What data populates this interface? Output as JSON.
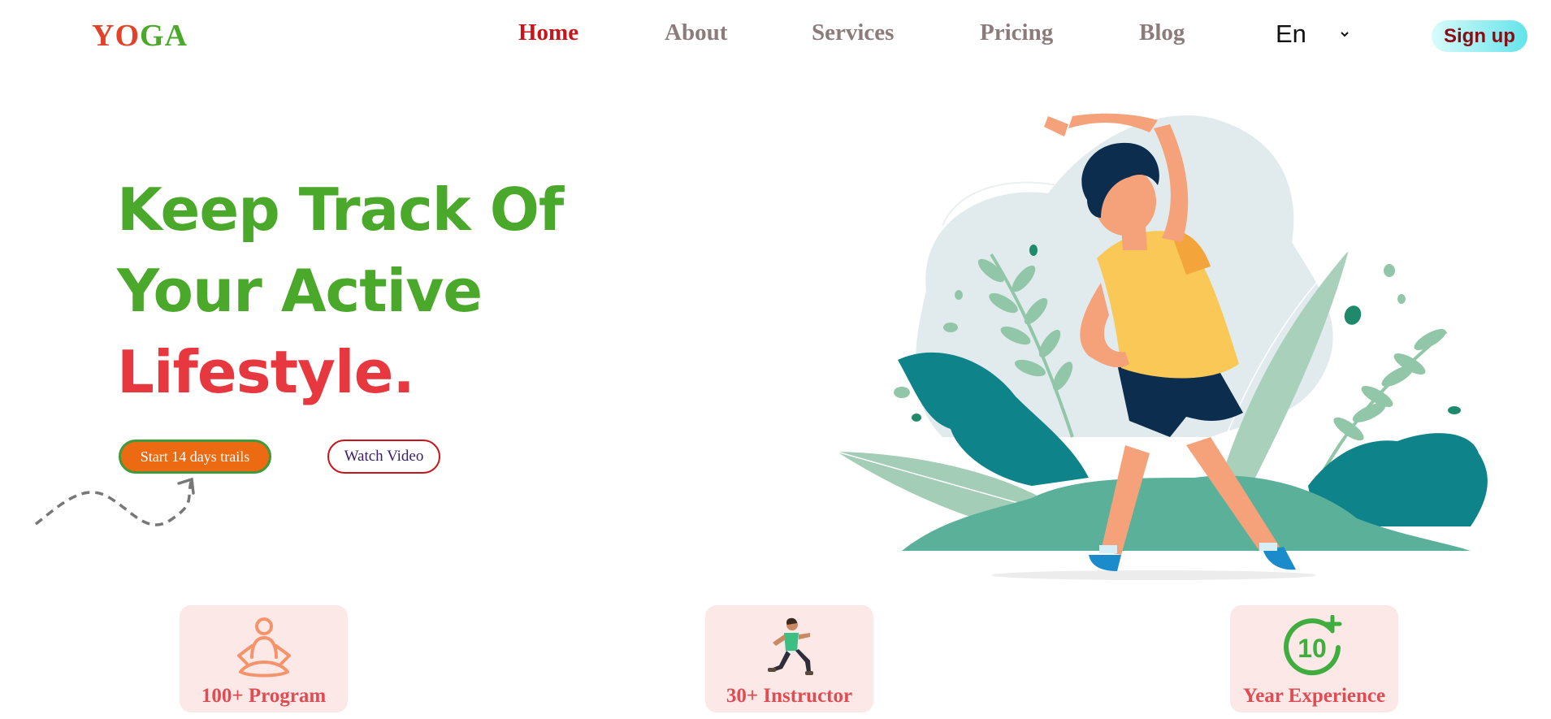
{
  "logo": {
    "letters": [
      "Y",
      "O",
      "G",
      "A"
    ],
    "colors": [
      "#e2422a",
      "#e2422a",
      "#4aa82a",
      "#4aa82a"
    ]
  },
  "nav": {
    "items": [
      {
        "label": "Home",
        "active": true
      },
      {
        "label": "About",
        "active": false
      },
      {
        "label": "Services",
        "active": false
      },
      {
        "label": "Pricing",
        "active": false
      },
      {
        "label": "Blog",
        "active": false
      }
    ],
    "language": "En",
    "signup_label": "Sign up"
  },
  "hero": {
    "line1": "Keep Track Of",
    "line2": "Your Active",
    "line3": "Lifestyle.",
    "primary_button": "Start 14 days trails",
    "secondary_button": "Watch Video"
  },
  "stats": [
    {
      "label": "100+ Program",
      "icon": "meditation-icon"
    },
    {
      "label": "30+ Instructor",
      "icon": "running-person-icon"
    },
    {
      "label": "Year Experience",
      "icon": "ten-plus-icon",
      "badge": "10"
    }
  ],
  "colors": {
    "accent_green": "#4aa82a",
    "accent_red": "#e8383f",
    "nav_active": "#c8151b",
    "button_orange": "#ec6a12",
    "card_bg": "#fde8e8"
  }
}
